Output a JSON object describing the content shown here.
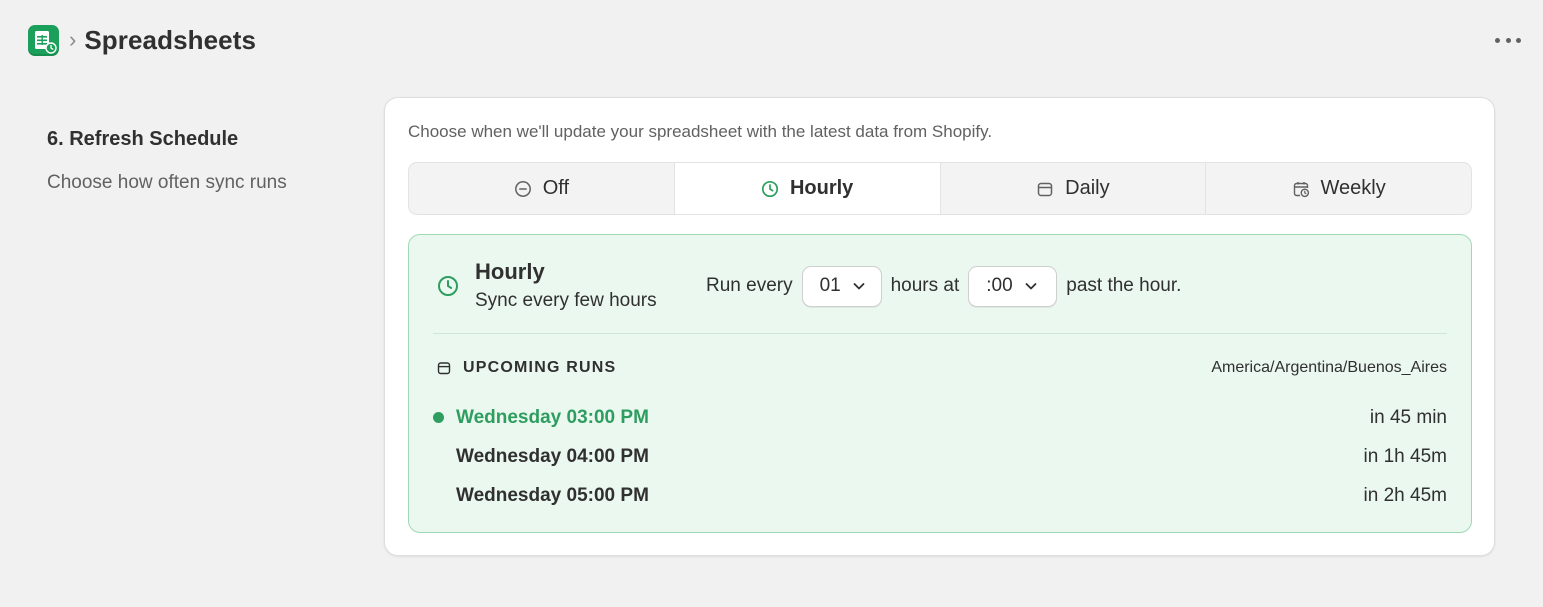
{
  "header": {
    "app_icon": "google-sheets-icon",
    "separator": "›",
    "title": "Spreadsheets",
    "more_icon": "more-horizontal-icon"
  },
  "section": {
    "title": "6. Refresh Schedule",
    "subtitle": "Choose how often sync runs"
  },
  "card": {
    "description": "Choose when we'll update your spreadsheet with the latest data from Shopify."
  },
  "tabs": [
    {
      "label": "Off",
      "icon": "minus-circle-icon",
      "active": false
    },
    {
      "label": "Hourly",
      "icon": "clock-icon",
      "active": true
    },
    {
      "label": "Daily",
      "icon": "calendar-icon",
      "active": false
    },
    {
      "label": "Weekly",
      "icon": "calendar-clock-icon",
      "active": false
    }
  ],
  "panel": {
    "title": "Hourly",
    "subtitle": "Sync every few hours",
    "run_every": "Run every",
    "hours_value": "01",
    "hours_at": "hours at",
    "minute_value": ":00",
    "past_hour": "past the hour.",
    "upcoming_label": "UPCOMING RUNS",
    "timezone": "America/Argentina/Buenos_Aires",
    "runs": [
      {
        "when": "Wednesday 03:00 PM",
        "relative": "in 45 min",
        "next": true
      },
      {
        "when": "Wednesday 04:00 PM",
        "relative": "in 1h 45m",
        "next": false
      },
      {
        "when": "Wednesday 05:00 PM",
        "relative": "in 2h 45m",
        "next": false
      }
    ]
  },
  "colors": {
    "accent_green": "#2e9e60",
    "panel_bg": "#ebf8ef",
    "panel_border": "#9fd8b4",
    "app_icon_green": "#1aa05a"
  }
}
